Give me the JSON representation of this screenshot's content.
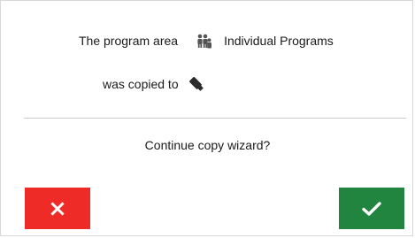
{
  "message": {
    "line1_prefix": "The program area",
    "area_icon": "user-group-icon",
    "area_name": "Individual Programs",
    "line2_prefix": "was copied to",
    "target_icon": "usb-stick-icon"
  },
  "prompt": {
    "question": "Continue copy wizard?"
  },
  "buttons": {
    "cancel": {
      "icon": "close-icon",
      "color": "#ef2b27"
    },
    "confirm": {
      "icon": "checkmark-icon",
      "color": "#21853f"
    }
  }
}
